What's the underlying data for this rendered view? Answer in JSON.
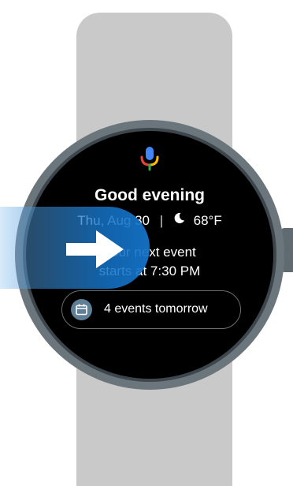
{
  "watch": {
    "greeting": "Good evening",
    "date": "Thu, Aug 30",
    "separator": "|",
    "temperature": "68°F",
    "event_line_1": "Your next event",
    "event_line_2": "starts at 7:30 PM",
    "chip_label": "4 events tomorrow"
  },
  "icons": {
    "mic": "google-assistant-mic-icon",
    "weather": "moon-icon",
    "calendar": "calendar-icon",
    "gesture": "swipe-right-arrow-icon"
  },
  "colors": {
    "screen_bg": "#000000",
    "band": "#c9c9c9",
    "bezel": "#6b757c",
    "overlay_blue": "#1473c8",
    "chip_icon_bg": "#5f7f97"
  }
}
